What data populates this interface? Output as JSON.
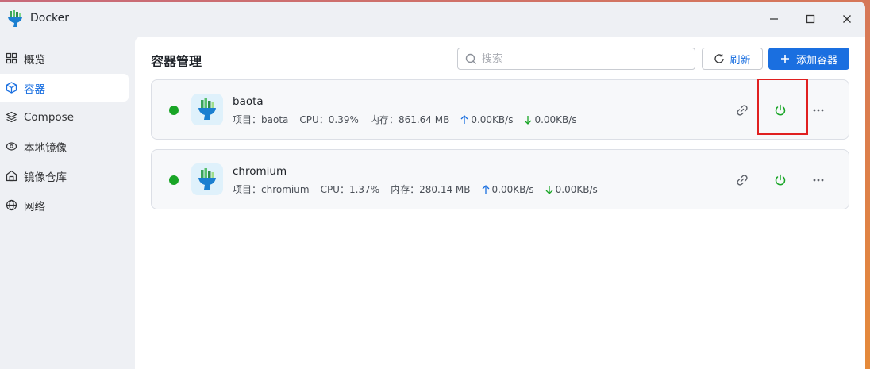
{
  "app": {
    "title": "Docker"
  },
  "sidebar": {
    "items": [
      {
        "label": "概览",
        "icon": "grid-icon"
      },
      {
        "label": "容器",
        "icon": "cube-icon",
        "active": true
      },
      {
        "label": "Compose",
        "icon": "layers-icon"
      },
      {
        "label": "本地镜像",
        "icon": "disc-icon"
      },
      {
        "label": "镜像仓库",
        "icon": "warehouse-icon"
      },
      {
        "label": "网络",
        "icon": "globe-icon"
      }
    ]
  },
  "main": {
    "title": "容器管理",
    "search_placeholder": "搜索",
    "refresh_label": "刷新",
    "add_label": "添加容器"
  },
  "containers": [
    {
      "name": "baota",
      "project_label": "项目：",
      "project": "baota",
      "cpu_label": "CPU：",
      "cpu": "0.39%",
      "mem_label": "内存：",
      "mem": "861.64 MB",
      "upload": "0.00KB/s",
      "download": "0.00KB/s",
      "status": "running"
    },
    {
      "name": "chromium",
      "project_label": "项目：",
      "project": "chromium",
      "cpu_label": "CPU：",
      "cpu": "1.37%",
      "mem_label": "内存：",
      "mem": "280.14 MB",
      "upload": "0.00KB/s",
      "download": "0.00KB/s",
      "status": "running"
    }
  ],
  "colors": {
    "accent": "#1a6fe0",
    "running": "#19a526",
    "power": "#19a526",
    "highlight": "#e02020"
  }
}
